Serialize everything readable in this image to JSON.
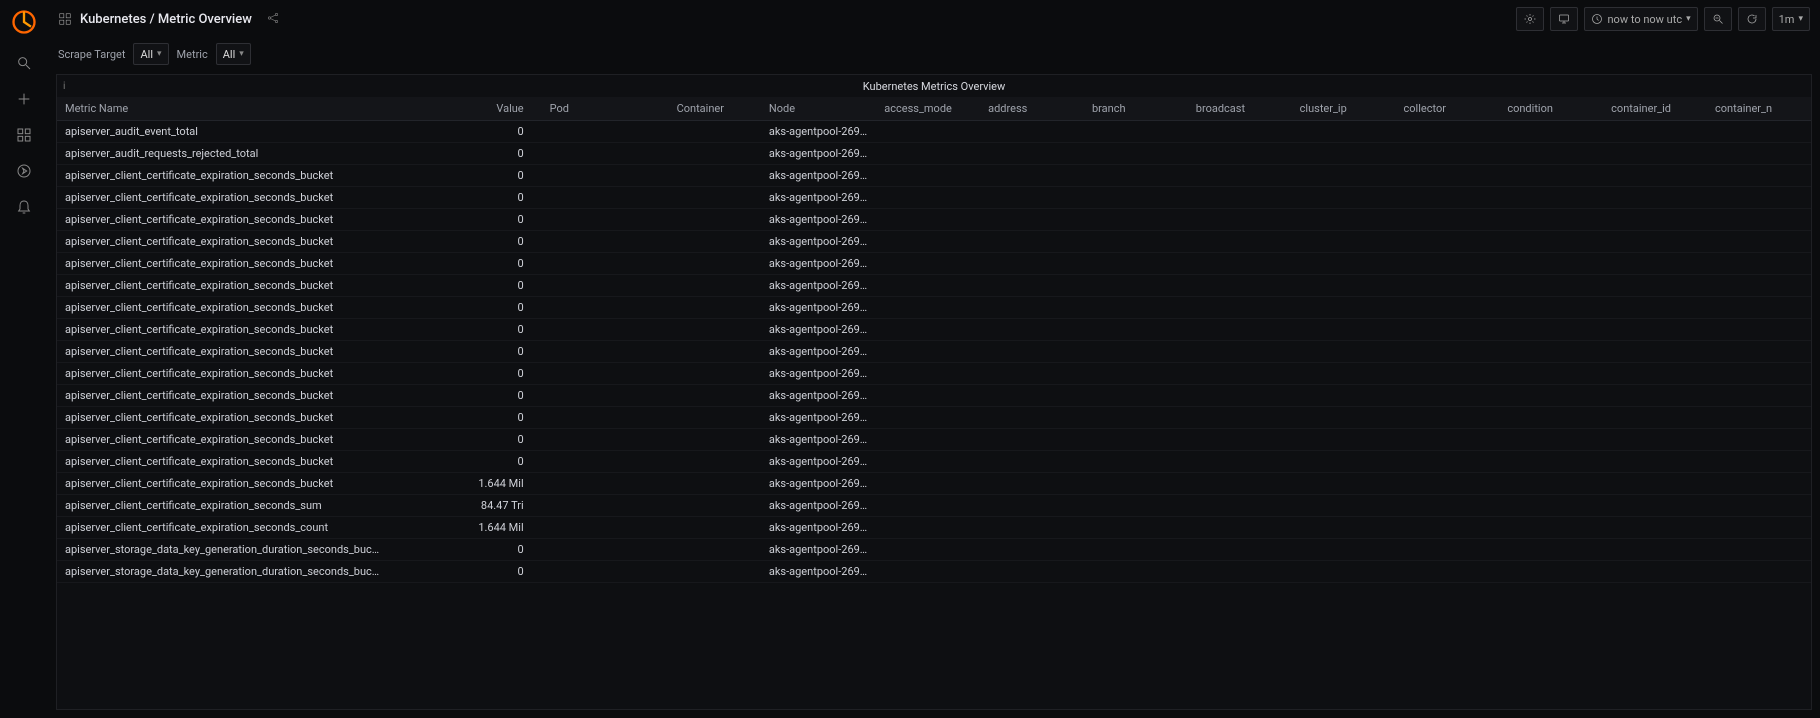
{
  "header": {
    "title": "Kubernetes / Metric Overview",
    "time_range": "now to now utc",
    "refresh": "1m"
  },
  "filters": {
    "scrape_target_label": "Scrape Target",
    "scrape_target_value": "All",
    "metric_label": "Metric",
    "metric_value": "All"
  },
  "panel": {
    "title": "Kubernetes Metrics Overview",
    "info_icon": "i",
    "columns": [
      "Metric Name",
      "Value",
      "Pod",
      "Container",
      "Node",
      "access_mode",
      "address",
      "branch",
      "broadcast",
      "cluster_ip",
      "collector",
      "condition",
      "container_id",
      "container_n"
    ],
    "rows": [
      {
        "metric": "apiserver_audit_event_total",
        "value": "0",
        "node": "aks-agentpool-269…"
      },
      {
        "metric": "apiserver_audit_requests_rejected_total",
        "value": "0",
        "node": "aks-agentpool-269…"
      },
      {
        "metric": "apiserver_client_certificate_expiration_seconds_bucket",
        "value": "0",
        "node": "aks-agentpool-269…"
      },
      {
        "metric": "apiserver_client_certificate_expiration_seconds_bucket",
        "value": "0",
        "node": "aks-agentpool-269…"
      },
      {
        "metric": "apiserver_client_certificate_expiration_seconds_bucket",
        "value": "0",
        "node": "aks-agentpool-269…"
      },
      {
        "metric": "apiserver_client_certificate_expiration_seconds_bucket",
        "value": "0",
        "node": "aks-agentpool-269…"
      },
      {
        "metric": "apiserver_client_certificate_expiration_seconds_bucket",
        "value": "0",
        "node": "aks-agentpool-269…"
      },
      {
        "metric": "apiserver_client_certificate_expiration_seconds_bucket",
        "value": "0",
        "node": "aks-agentpool-269…"
      },
      {
        "metric": "apiserver_client_certificate_expiration_seconds_bucket",
        "value": "0",
        "node": "aks-agentpool-269…"
      },
      {
        "metric": "apiserver_client_certificate_expiration_seconds_bucket",
        "value": "0",
        "node": "aks-agentpool-269…"
      },
      {
        "metric": "apiserver_client_certificate_expiration_seconds_bucket",
        "value": "0",
        "node": "aks-agentpool-269…"
      },
      {
        "metric": "apiserver_client_certificate_expiration_seconds_bucket",
        "value": "0",
        "node": "aks-agentpool-269…"
      },
      {
        "metric": "apiserver_client_certificate_expiration_seconds_bucket",
        "value": "0",
        "node": "aks-agentpool-269…"
      },
      {
        "metric": "apiserver_client_certificate_expiration_seconds_bucket",
        "value": "0",
        "node": "aks-agentpool-269…"
      },
      {
        "metric": "apiserver_client_certificate_expiration_seconds_bucket",
        "value": "0",
        "node": "aks-agentpool-269…"
      },
      {
        "metric": "apiserver_client_certificate_expiration_seconds_bucket",
        "value": "0",
        "node": "aks-agentpool-269…"
      },
      {
        "metric": "apiserver_client_certificate_expiration_seconds_bucket",
        "value": "1.644 Mil",
        "node": "aks-agentpool-269…"
      },
      {
        "metric": "apiserver_client_certificate_expiration_seconds_sum",
        "value": "84.47 Tri",
        "node": "aks-agentpool-269…"
      },
      {
        "metric": "apiserver_client_certificate_expiration_seconds_count",
        "value": "1.644 Mil",
        "node": "aks-agentpool-269…"
      },
      {
        "metric": "apiserver_storage_data_key_generation_duration_seconds_buc…",
        "value": "0",
        "node": "aks-agentpool-269…"
      },
      {
        "metric": "apiserver_storage_data_key_generation_duration_seconds_buc…",
        "value": "0",
        "node": "aks-agentpool-269…"
      }
    ]
  }
}
